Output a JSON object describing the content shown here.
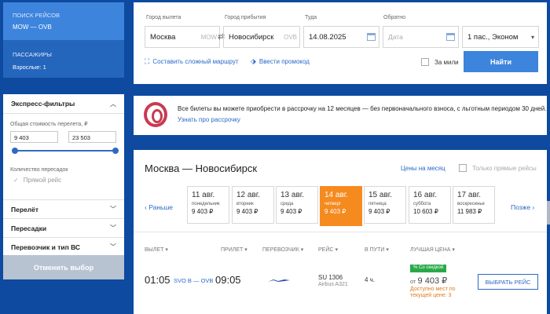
{
  "sidebar": {
    "search_title": "ПОИСК РЕЙСОВ",
    "route": "MOW — OVB",
    "pax_title": "ПАССАЖИРЫ",
    "pax_value": "Взрослые: 1",
    "express_filters": "Экспресс-фильтры",
    "price_label": "Общая стоимость перелета, ₽",
    "price_min": "9 403",
    "price_max": "23 503",
    "stops_label": "Количество пересадок",
    "direct_label": "Прямой рейс",
    "sections": [
      "Перелёт",
      "Пересадки",
      "Перевозчик и тип ВС"
    ],
    "reset": "Отменить выбор"
  },
  "search": {
    "from_label": "Город вылета",
    "from_value": "Москва",
    "from_code": "MOW",
    "to_label": "Город прибытия",
    "to_value": "Новосибирск",
    "to_code": "OVB",
    "depart_label": "Туда",
    "depart_value": "14.08.2025",
    "return_label": "Обратно",
    "return_placeholder": "Дата",
    "pax_value": "1 пас., Эконом",
    "complex_route": "Составить сложный маршрут",
    "promo": "Ввести промокод",
    "miles": "За мили",
    "find": "Найти"
  },
  "banner": {
    "text": "Все билеты вы можете приобрести в рассрочку на 12 месяцев — без первоначального взноса, с льготным периодом 30 дней.",
    "link": "Узнать про рассрочку"
  },
  "results": {
    "title": "Москва — Новосибирск",
    "month_prices": "Цены на месяц",
    "direct_only": "Только прямые рейсы",
    "prev": "Раньше",
    "next": "Позже",
    "days": [
      {
        "date": "11 авг.",
        "weekday": "понедельник",
        "price": "9 403 ₽"
      },
      {
        "date": "12 авг.",
        "weekday": "вторник",
        "price": "9 403 ₽"
      },
      {
        "date": "13 авг.",
        "weekday": "среда",
        "price": "9 403 ₽"
      },
      {
        "date": "14 авг.",
        "weekday": "четверг",
        "price": "9 403 ₽"
      },
      {
        "date": "15 авг.",
        "weekday": "пятница",
        "price": "9 403 ₽"
      },
      {
        "date": "16 авг.",
        "weekday": "суббота",
        "price": "10 603 ₽"
      },
      {
        "date": "17 авг.",
        "weekday": "воскресенье",
        "price": "11 983 ₽"
      }
    ],
    "columns": {
      "departure": "ВЫЛЕТ",
      "arrival": "ПРИЛЕТ",
      "carrier": "ПЕРЕВОЗЧИК",
      "flight": "РЕЙС",
      "duration": "В ПУТИ",
      "best_price": "ЛУЧШАЯ ЦЕНА"
    },
    "flight": {
      "dep_time": "01:05",
      "codes": "SVO B — OVB",
      "arr_time": "09:05",
      "number": "SU 1306",
      "aircraft": "Airbus A321",
      "duration": "4 ч.",
      "discount": "% Со скидкой",
      "price_prefix": "от",
      "price": "9 403 ₽",
      "seats": "Доступно мест по текущей цене: 3",
      "choose": "ВЫБРАТЬ РЕЙС"
    }
  },
  "colors": {
    "background": "#0d4aa0",
    "accent": "#3d84dd",
    "active_day": "#f58a1f",
    "discount": "#2aa94a",
    "brand_banner": "#c93a52"
  }
}
